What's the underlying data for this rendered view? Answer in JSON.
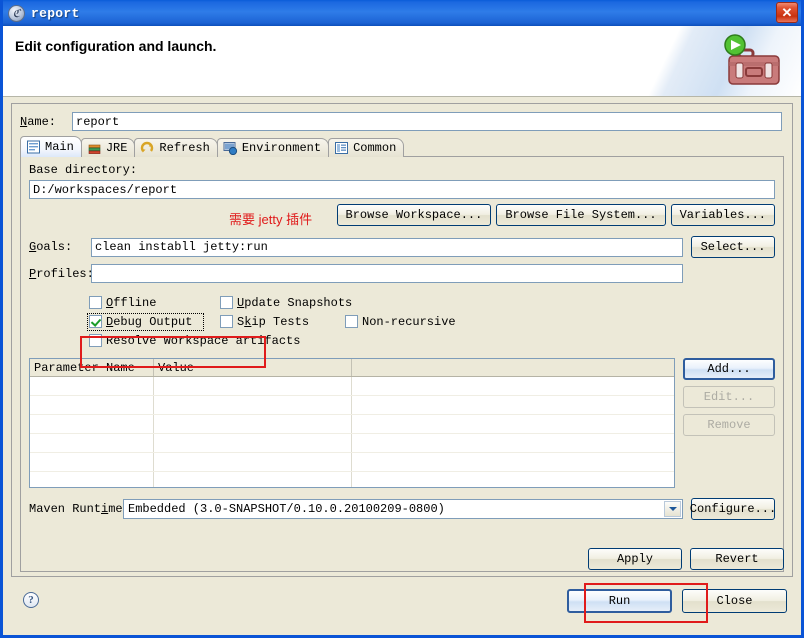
{
  "window": {
    "title": "report",
    "icon": "app-icon",
    "close_label": "✕"
  },
  "header": {
    "title": "Edit configuration and launch.",
    "graphic": "toolbox-with-run-badge-icon"
  },
  "name_field": {
    "label": "Name:",
    "mnemonic": "N",
    "value": "report"
  },
  "tabs": [
    {
      "label": "Main",
      "icon": "main-tab-icon",
      "active": true
    },
    {
      "label": "JRE",
      "icon": "jre-tab-icon",
      "active": false
    },
    {
      "label": "Refresh",
      "icon": "refresh-tab-icon",
      "active": false
    },
    {
      "label": "Environment",
      "icon": "environment-tab-icon",
      "active": false
    },
    {
      "label": "Common",
      "icon": "common-tab-icon",
      "active": false
    }
  ],
  "main": {
    "base_directory": {
      "label": "Base directory:",
      "value": "D:/workspaces/report"
    },
    "browse_workspace": "Browse Workspace...",
    "browse_file_system": "Browse File System...",
    "variables": "Variables...",
    "annotation": "需要 jetty 插件",
    "goals": {
      "label": "Goals:",
      "value": "clean instabll jetty:run"
    },
    "select_button": "Select...",
    "profiles": {
      "label": "Profiles:",
      "value": ""
    },
    "checkboxes": [
      {
        "label": "Offline",
        "checked": false,
        "focused": false
      },
      {
        "label": "Update Snapshots",
        "checked": false,
        "focused": false
      },
      {
        "label": "Debug Output",
        "checked": true,
        "focused": true
      },
      {
        "label": "Skip Tests",
        "checked": false,
        "focused": false
      },
      {
        "label": "Non-recursive",
        "checked": false,
        "focused": false
      },
      {
        "label": "Resolve Workspace artifacts",
        "checked": false,
        "focused": false
      }
    ],
    "table": {
      "columns": [
        "Parameter Name",
        "Value",
        ""
      ],
      "rows": [],
      "empty_row_count": 10
    },
    "table_buttons": [
      {
        "label": "Add...",
        "enabled": true
      },
      {
        "label": "Edit...",
        "enabled": false
      },
      {
        "label": "Remove",
        "enabled": false
      }
    ],
    "maven_runtime": {
      "label": "Maven Runtime:",
      "value": "Embedded  (3.0-SNAPSHOT/0.10.0.20100209-0800)",
      "configure": "Configure..."
    }
  },
  "footer": {
    "apply": "Apply",
    "revert": "Revert",
    "run": "Run",
    "close": "Close",
    "help": "?"
  },
  "colors": {
    "accent": "#0a54d6",
    "face": "#ece9d8",
    "annotation_red": "#e01b1b",
    "field_border": "#7f9db9"
  }
}
